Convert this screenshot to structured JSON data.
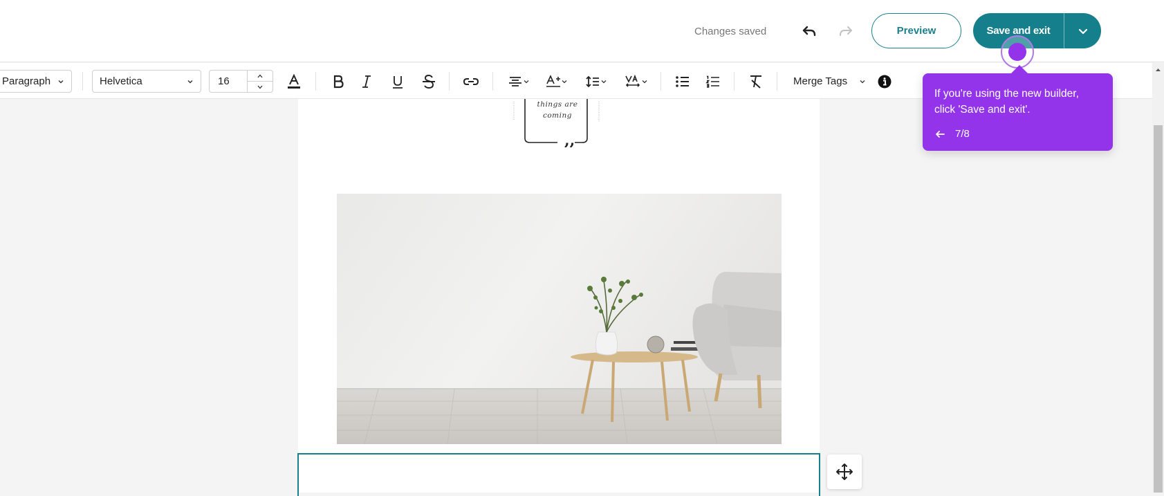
{
  "header": {
    "status": "Changes saved",
    "preview_label": "Preview",
    "save_label": "Save and exit"
  },
  "toolbar": {
    "paragraph": "Paragraph",
    "font": "Helvetica",
    "font_size": "16",
    "merge_tags": "Merge Tags"
  },
  "content": {
    "quote_line1": "things are",
    "quote_line2": "coming"
  },
  "tooltip": {
    "text": "If you're using the new builder, click 'Save and exit'.",
    "step": "7/8"
  },
  "colors": {
    "accent": "#15808c",
    "tooltip": "#9333ea"
  }
}
